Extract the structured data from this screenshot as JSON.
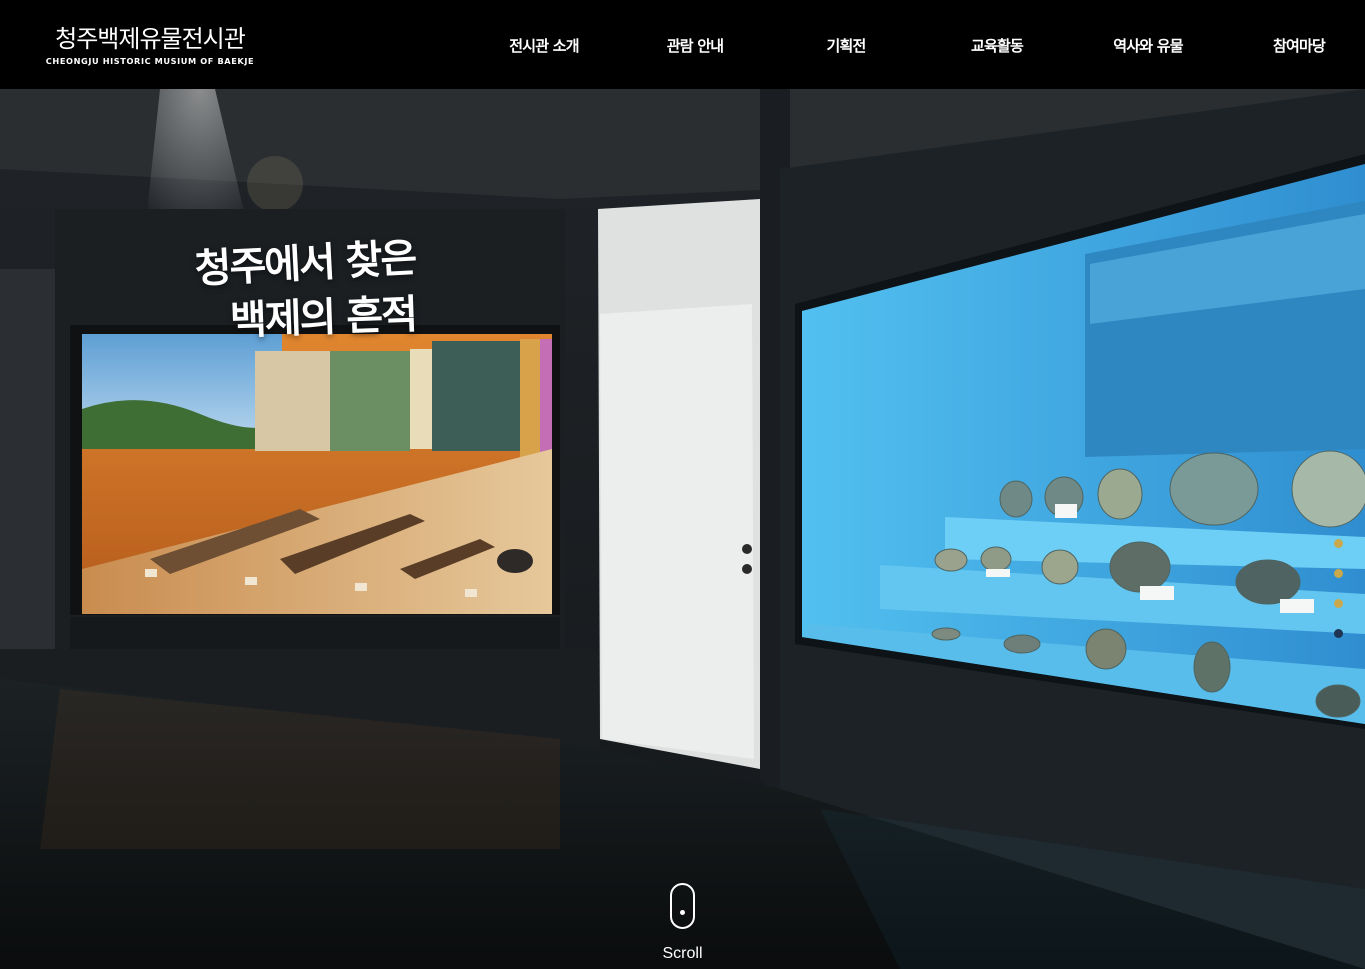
{
  "header": {
    "logo_ko": "청주백제유물전시관",
    "logo_en": "CHEONGJU HISTORIC MUSIUM OF BAEKJE",
    "nav": [
      {
        "label": "전시관 소개"
      },
      {
        "label": "관람 안내"
      },
      {
        "label": "기획전"
      },
      {
        "label": "교육활동"
      },
      {
        "label": "역사와 유물"
      },
      {
        "label": "참여마당"
      }
    ]
  },
  "hero": {
    "title_line1": "청주에서 찾은",
    "title_line2": "백제의 흔적",
    "slides": {
      "count": 4,
      "active_index": 3
    },
    "scroll_label": "Scroll"
  },
  "colors": {
    "header_bg": "#000000",
    "dot_inactive": "#c9a94b",
    "dot_active": "#1f3553",
    "case_blue": "#3ba8de",
    "diorama_orange": "#d98a3a"
  }
}
